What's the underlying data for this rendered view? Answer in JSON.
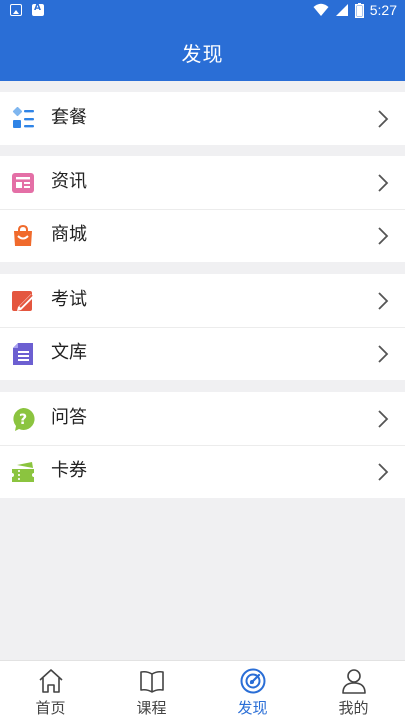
{
  "status_bar": {
    "time": "5:27",
    "icons": [
      "image-icon",
      "a-badge-icon",
      "wifi-icon",
      "signal-icon",
      "battery-icon"
    ]
  },
  "header": {
    "title": "发现"
  },
  "groups": [
    {
      "items": [
        {
          "label": "套餐",
          "icon": "package-grid-icon",
          "color": "#3a8ee6"
        }
      ]
    },
    {
      "items": [
        {
          "label": "资讯",
          "icon": "news-icon",
          "color": "#e46fa6"
        },
        {
          "label": "商城",
          "icon": "shopping-bag-icon",
          "color": "#f06a2c"
        }
      ]
    },
    {
      "items": [
        {
          "label": "考试",
          "icon": "exam-pen-icon",
          "color": "#e4563f"
        },
        {
          "label": "文库",
          "icon": "library-doc-icon",
          "color": "#6c5fd1"
        }
      ]
    },
    {
      "items": [
        {
          "label": "问答",
          "icon": "question-bubble-icon",
          "color": "#8bc43f"
        },
        {
          "label": "卡券",
          "icon": "ticket-icon",
          "color": "#8bc43f"
        }
      ]
    }
  ],
  "tabbar": {
    "tabs": [
      {
        "label": "首页",
        "icon": "home-icon"
      },
      {
        "label": "课程",
        "icon": "book-icon"
      },
      {
        "label": "发现",
        "icon": "compass-icon",
        "active": true
      },
      {
        "label": "我的",
        "icon": "profile-icon"
      }
    ],
    "active_color": "#2a6ed6"
  }
}
